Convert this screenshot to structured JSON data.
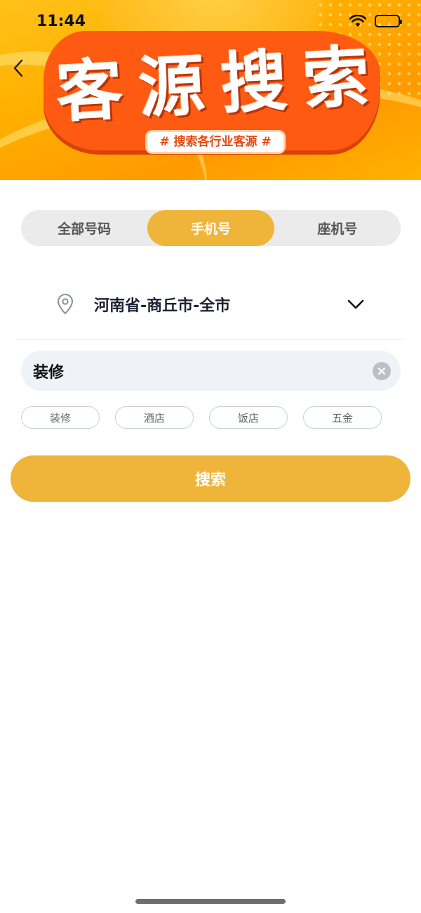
{
  "status_bar": {
    "time": "11:44",
    "icons": [
      "wifi-icon",
      "battery-icon"
    ]
  },
  "banner": {
    "title_chars": [
      "客",
      "源",
      "搜",
      "索"
    ],
    "subtitle": "# 搜索各行业客源 #",
    "back_icon": "chevron-left-icon"
  },
  "tabs": [
    {
      "label": "全部号码",
      "active": false
    },
    {
      "label": "手机号",
      "active": true
    },
    {
      "label": "座机号",
      "active": false
    }
  ],
  "location": {
    "icon": "location-pin-icon",
    "value": "河南省-商丘市-全市",
    "dropdown_icon": "chevron-down-icon"
  },
  "search": {
    "value": "装修",
    "clear_icon": "clear-icon"
  },
  "tags": [
    "装修",
    "酒店",
    "饭店",
    "五金"
  ],
  "search_button": {
    "label": "搜索"
  },
  "colors": {
    "accent": "#efb43a",
    "banner_orange": "#ff5a12",
    "banner_yellow": "#ffb000",
    "text_dark": "#1c2233"
  }
}
